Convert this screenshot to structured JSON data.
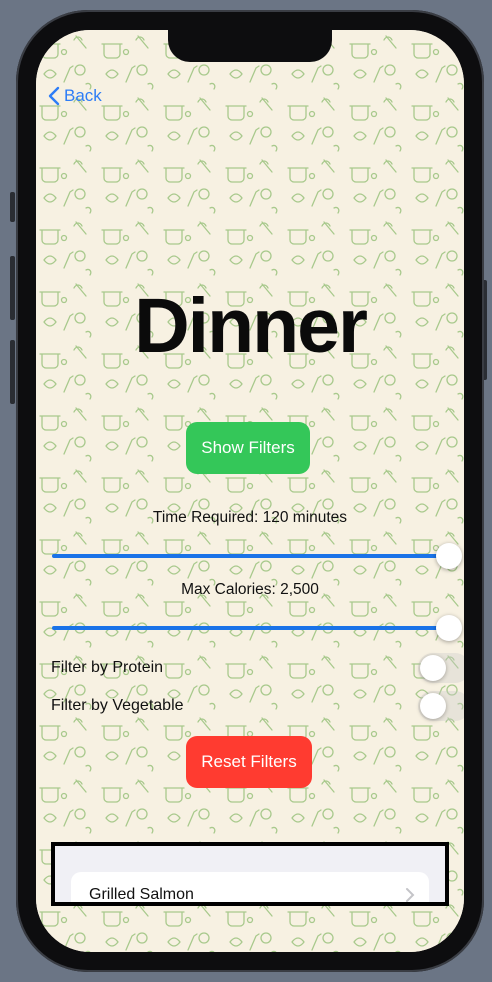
{
  "nav": {
    "back_label": "Back"
  },
  "page": {
    "title": "Dinner"
  },
  "filters": {
    "show_label": "Show Filters",
    "time_label": "Time Required: 120 minutes",
    "time_value_fraction": 1.0,
    "calories_label": "Max Calories: 2,500",
    "calories_value_fraction": 1.0,
    "protein_label": "Filter by Protein",
    "protein_on": false,
    "vegetable_label": "Filter by Vegetable",
    "vegetable_on": false,
    "reset_label": "Reset Filters"
  },
  "list": {
    "items": [
      {
        "label": "Grilled Salmon"
      }
    ]
  },
  "colors": {
    "accent": "#1a73e8",
    "show_button": "#34c759",
    "reset_button": "#ff3b30",
    "background": "#f7f1e2"
  }
}
